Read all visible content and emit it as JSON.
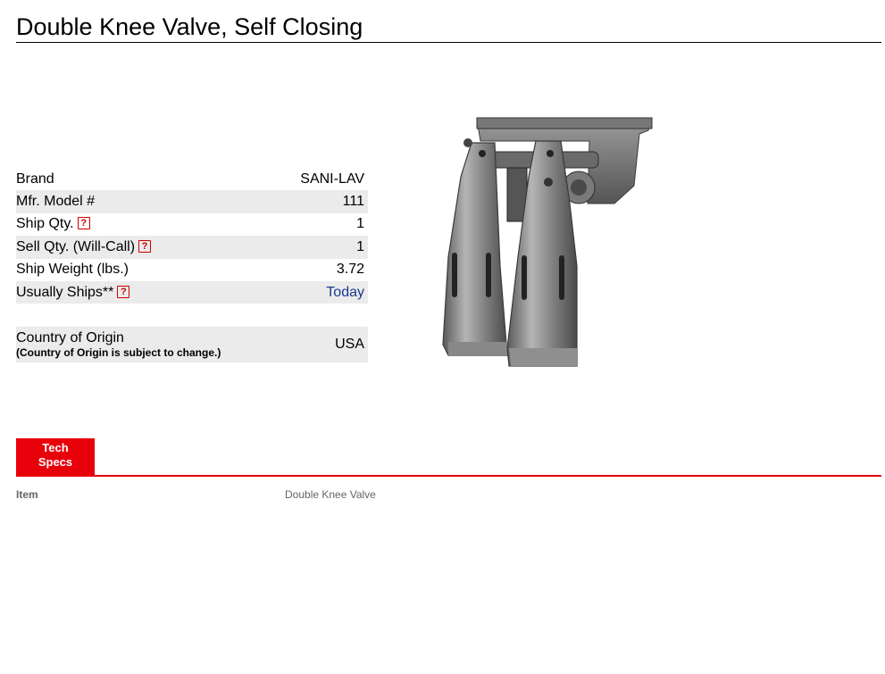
{
  "product": {
    "title": "Double Knee Valve, Self Closing",
    "image_alt": "Double knee valve product photo"
  },
  "specs": [
    {
      "label": "Brand",
      "value": "SANI-LAV",
      "help": false,
      "link": false
    },
    {
      "label": "Mfr. Model #",
      "value": "111",
      "help": false,
      "link": false
    },
    {
      "label": "Ship Qty.",
      "value": "1",
      "help": true,
      "link": false
    },
    {
      "label": "Sell Qty. (Will-Call)",
      "value": "1",
      "help": true,
      "link": false
    },
    {
      "label": "Ship Weight (lbs.)",
      "value": "3.72",
      "help": false,
      "link": false
    },
    {
      "label": "Usually Ships**",
      "value": "Today",
      "help": true,
      "link": true
    }
  ],
  "origin": {
    "label": "Country of Origin",
    "note": "(Country of Origin is subject to change.)",
    "value": "USA"
  },
  "help_glyph": "?",
  "tabs": {
    "tech_specs_line1": "Tech",
    "tech_specs_line2": "Specs"
  },
  "details": {
    "item_label": "Item",
    "item_value": "Double Knee Valve"
  },
  "colors": {
    "accent": "#e8000b",
    "link": "#1a3a8f",
    "row_shade": "#ebebeb"
  }
}
